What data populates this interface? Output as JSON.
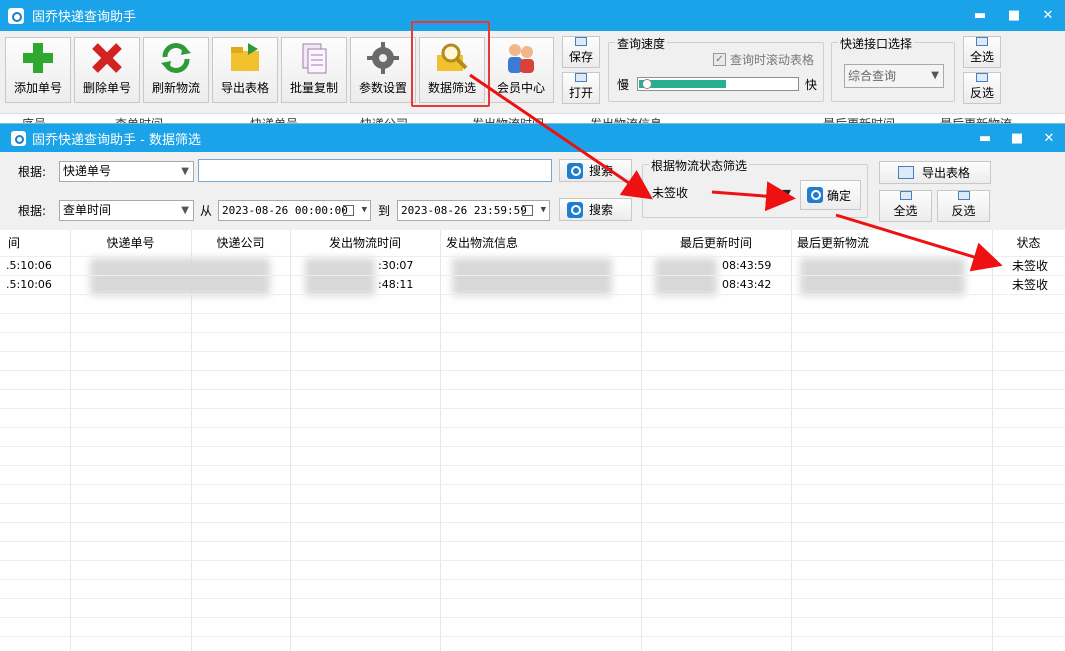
{
  "main_window": {
    "title": "固乔快递查询助手",
    "toolbar": [
      {
        "label": "添加单号",
        "icon": "plus-icon"
      },
      {
        "label": "删除单号",
        "icon": "delete-x-icon"
      },
      {
        "label": "刷新物流",
        "icon": "refresh-icon"
      },
      {
        "label": "导出表格",
        "icon": "export-folder-icon"
      },
      {
        "label": "批量复制",
        "icon": "copy-docs-icon"
      },
      {
        "label": "参数设置",
        "icon": "gear-icon"
      },
      {
        "label": "数据筛选",
        "icon": "magnifier-filter-icon"
      },
      {
        "label": "会员中心",
        "icon": "members-icon"
      }
    ],
    "save_label": "保存",
    "open_label": "打开",
    "speed_group": {
      "title": "查询速度",
      "scroll_checkbox": "查询时滚动表格",
      "slow": "慢",
      "fast": "快",
      "progress": 0.55
    },
    "interface_group": {
      "title": "快递接口选择",
      "selected": "综合查询"
    },
    "select_all": "全选",
    "invert": "反选",
    "bg_columns": [
      "序号",
      "查单时间",
      "快递单号",
      "快递公司",
      "发出物流时间",
      "发出物流信息",
      "最后更新时间",
      "最后更新物流"
    ]
  },
  "filter_window": {
    "title": "固乔快递查询助手 - 数据筛选",
    "row1": {
      "label": "根据:",
      "field": "快递单号",
      "search": "搜索"
    },
    "row2": {
      "label": "根据:",
      "field": "查单时间",
      "from": "从",
      "from_date": "2023-08-26 00:00:00",
      "to": "到",
      "to_date": "2023-08-26 23:59:59",
      "search": "搜索"
    },
    "status_group": {
      "title": "根据物流状态筛选",
      "selected": "未签收",
      "confirm": "确定"
    },
    "export": "导出表格",
    "select_all": "全选",
    "invert": "反选",
    "columns": [
      "间",
      "快递单号",
      "快递公司",
      "发出物流时间",
      "发出物流信息",
      "最后更新时间",
      "最后更新物流",
      "状态"
    ],
    "rows": [
      {
        "time": ".5:10:06",
        "send_time": ":30:07",
        "update_time": "08:43:59",
        "status": "未签收"
      },
      {
        "time": ".5:10:06",
        "send_time": ":48:11",
        "update_time": "08:43:42",
        "status": "未签收"
      }
    ]
  },
  "colors": {
    "titlebar": "#1aa3e8",
    "highlight": "#e53935",
    "arrow": "#ee1111"
  }
}
